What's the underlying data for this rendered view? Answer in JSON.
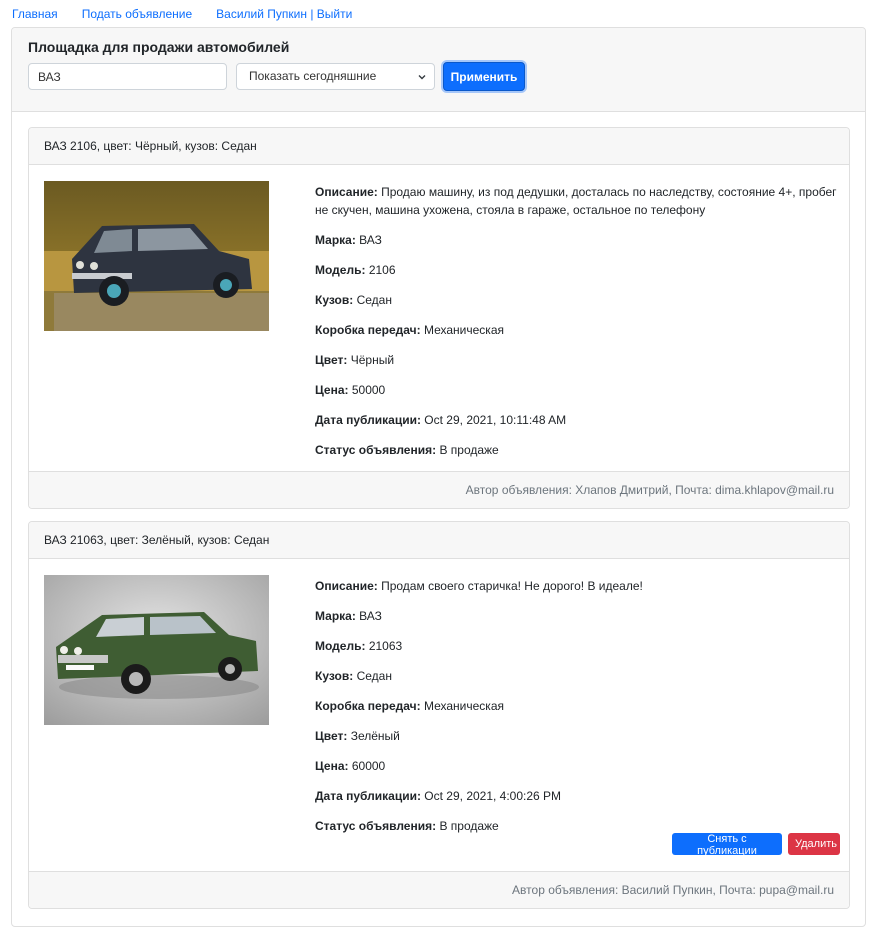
{
  "nav": {
    "home": "Главная",
    "post_ad": "Подать объявление",
    "user_logout": "Василий Пупкин | Выйти"
  },
  "header": {
    "title": "Площадка для продажи автомобилей",
    "search_value": "ВАЗ",
    "period_selected": "Показать сегодняшние",
    "apply_label": "Применить"
  },
  "labels": {
    "description": "Описание:",
    "brand": "Марка:",
    "model": "Модель:",
    "body": "Кузов:",
    "gearbox": "Коробка передач:",
    "color": "Цвет:",
    "price": "Цена:",
    "published": "Дата публикации:",
    "status": "Статус объявления:"
  },
  "listings": [
    {
      "title": "ВАЗ 2106, цвет: Чёрный, кузов: Седан",
      "description": "Продаю машину, из под дедушки, досталась по наследству, состояние 4+, пробег не скучен, машина ухожена, стояла в гараже, остальное по телефону",
      "brand": "ВАЗ",
      "model": "2106",
      "body": "Седан",
      "gearbox": "Механическая",
      "color": "Чёрный",
      "price": "50000",
      "published": "Oct 29, 2021, 10:11:48 AM",
      "status": "В продаже",
      "author": "Автор объявления: Хлапов Дмитрий, Почта: dima.khlapov@mail.ru"
    },
    {
      "title": "ВАЗ 21063, цвет: Зелёный, кузов: Седан",
      "description": "Продам своего старичка! Не дорого! В идеале!",
      "brand": "ВАЗ",
      "model": "21063",
      "body": "Седан",
      "gearbox": "Механическая",
      "color": "Зелёный",
      "price": "60000",
      "published": "Oct 29, 2021, 4:00:26 PM",
      "status": "В продаже",
      "author": "Автор объявления: Василий Пупкин, Почта: pupa@mail.ru",
      "unpublish_label": "Снять с публикации",
      "delete_label": "Удалить"
    }
  ],
  "colors": {
    "primary": "#0d6efd",
    "danger": "#dc3545",
    "muted": "#6c757d",
    "header_bg": "#f7f7f7"
  }
}
